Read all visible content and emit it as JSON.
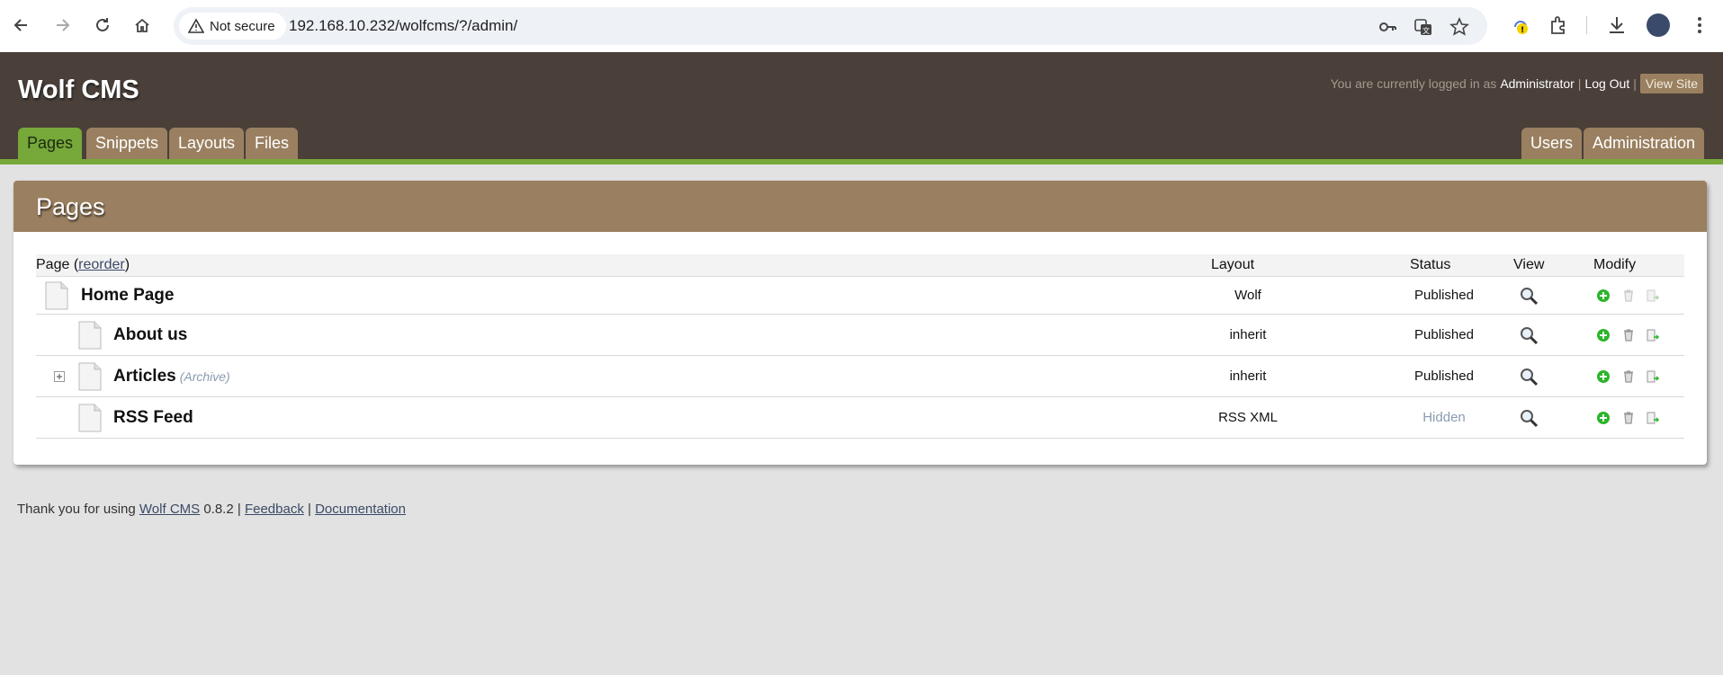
{
  "browser": {
    "security_label": "Not secure",
    "url": "192.168.10.232/wolfcms/?/admin/"
  },
  "header": {
    "site_title": "Wolf CMS",
    "login_prefix": "You are currently logged in as",
    "user": "Administrator",
    "separator": "|",
    "logout": "Log Out",
    "view_site": "View Site",
    "tabs_left": [
      "Pages",
      "Snippets",
      "Layouts",
      "Files"
    ],
    "tabs_right": [
      "Users",
      "Administration"
    ],
    "active_tab": "Pages"
  },
  "panel": {
    "title": "Pages",
    "columns": {
      "page": "Page",
      "reorder_open": "(",
      "reorder": "reorder",
      "reorder_close": ")",
      "layout": "Layout",
      "status": "Status",
      "view": "View",
      "modify": "Modify"
    },
    "rows": [
      {
        "name": "Home Page",
        "tag": "",
        "layout": "Wolf",
        "status": "Published",
        "level": 0,
        "expandable": false
      },
      {
        "name": "About us",
        "tag": "",
        "layout": "inherit",
        "status": "Published",
        "level": 1,
        "expandable": false
      },
      {
        "name": "Articles",
        "tag": "(Archive)",
        "layout": "inherit",
        "status": "Published",
        "level": 1,
        "expandable": true
      },
      {
        "name": "RSS Feed",
        "tag": "",
        "layout": "RSS XML",
        "status": "Hidden",
        "level": 1,
        "expandable": false
      }
    ]
  },
  "footer": {
    "prefix": "Thank you for using",
    "cms_link": "Wolf CMS",
    "version": "0.8.2",
    "separator": "|",
    "feedback": "Feedback",
    "documentation": "Documentation"
  },
  "colors": {
    "header_bg": "#4a3f39",
    "tab_bg": "#9a8060",
    "active_tab": "#76a83a",
    "page_bg": "#e2e2e2"
  }
}
